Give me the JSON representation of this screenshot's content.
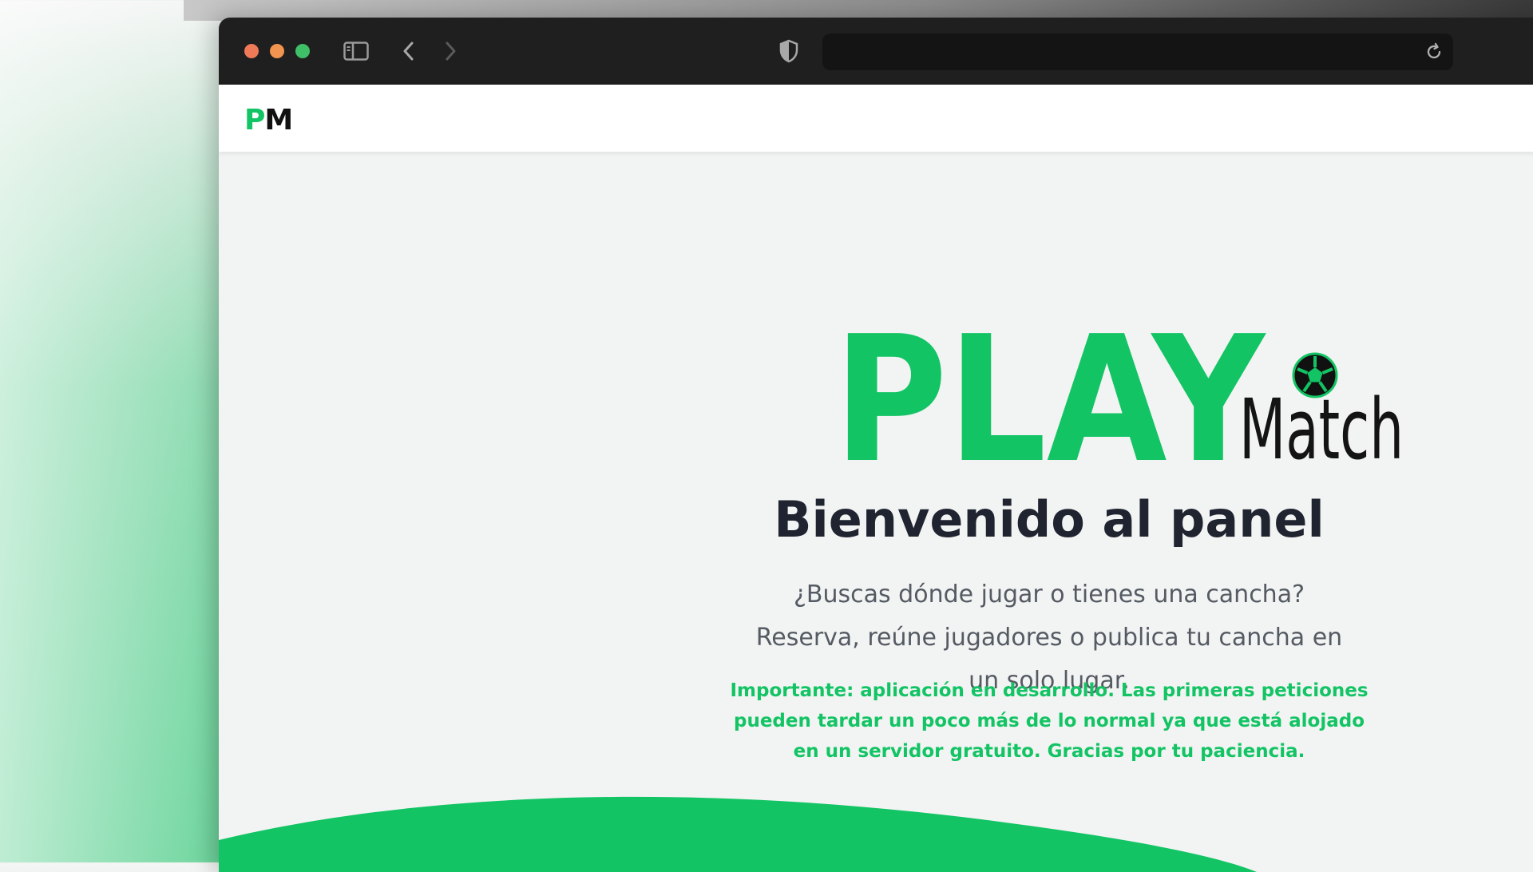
{
  "browser": {
    "icons": {
      "sidebar": "sidebar-icon",
      "back": "chevron-left-icon",
      "forward": "chevron-right-icon",
      "shield": "shield-icon",
      "reload": "reload-icon"
    },
    "address_value": ""
  },
  "navbar": {
    "brand_first": "P",
    "brand_second": "M"
  },
  "hero": {
    "logo_text_main": "PLAY",
    "logo_text_secondary": "Match",
    "title": "Bienvenido al panel",
    "subtitle": "¿Buscas dónde jugar o tienes una cancha? Reserva, reúne jugadores o publica tu cancha en un solo lugar.",
    "notice": "Importante: aplicación en desarrollo. Las primeras peticiones pueden tardar un poco más de lo normal ya que está alojado en un servidor gratuito. Gracias por tu paciencia."
  },
  "colors": {
    "brand_green": "#13c464",
    "dark_text": "#1f2430",
    "muted_text": "#555b63",
    "toolbar": "#1f1f1f"
  }
}
